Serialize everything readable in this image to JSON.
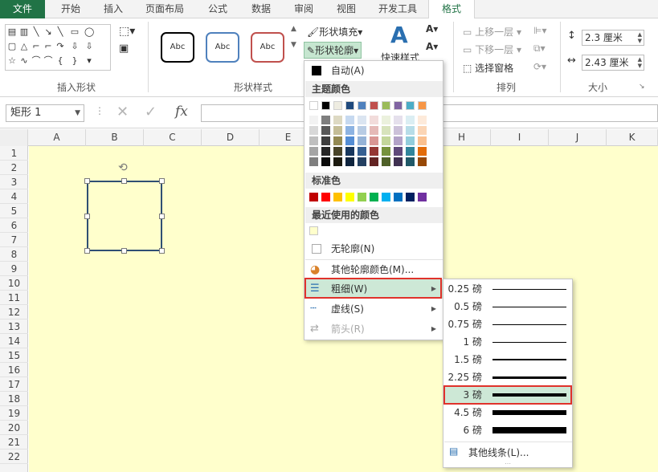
{
  "tabs": [
    "文件",
    "开始",
    "插入",
    "页面布局",
    "公式",
    "数据",
    "审阅",
    "视图",
    "开发工具",
    "格式"
  ],
  "ribbon": {
    "groups": {
      "insert_shapes": "插入形状",
      "shape_styles": "形状样式",
      "arrange": "排列",
      "size": "大小"
    },
    "style_samples": [
      "Abc",
      "Abc",
      "Abc"
    ],
    "shape_fill": "形状填充",
    "shape_outline": "形状轮廓",
    "quick_styles": "快速样式",
    "bring_forward": "上移一层",
    "send_backward": "下移一层",
    "selection_pane": "选择窗格",
    "height_value": "2.3 厘米",
    "width_value": "2.43 厘米"
  },
  "formula_bar": {
    "name_box": "矩形 1",
    "fx": "fx"
  },
  "columns": [
    "A",
    "B",
    "C",
    "D",
    "E",
    "F",
    "G",
    "H",
    "I",
    "J",
    "K"
  ],
  "rows": [
    "1",
    "2",
    "3",
    "4",
    "5",
    "6",
    "7",
    "8",
    "9",
    "10",
    "11",
    "12",
    "13",
    "14",
    "15",
    "16",
    "17",
    "18",
    "19",
    "20",
    "21",
    "22"
  ],
  "outline_menu": {
    "auto": "自动(A)",
    "theme_colors_header": "主题颜色",
    "standard_colors_header": "标准色",
    "recent_colors_header": "最近使用的颜色",
    "no_outline": "无轮廓(N)",
    "more_colors": "其他轮廓颜色(M)...",
    "weight": "粗细(W)",
    "dashes": "虚线(S)",
    "arrows": "箭头(R)",
    "theme_top_row": [
      "#ffffff",
      "#000000",
      "#eeece1",
      "#1f497d",
      "#4f81bd",
      "#c0504d",
      "#9bbb59",
      "#8064a2",
      "#4bacc6",
      "#f79646"
    ],
    "theme_shades": [
      [
        "#f2f2f2",
        "#d8d8d8",
        "#bfbfbf",
        "#a5a5a5",
        "#7f7f7f"
      ],
      [
        "#7f7f7f",
        "#595959",
        "#3f3f3f",
        "#262626",
        "#0c0c0c"
      ],
      [
        "#ddd9c3",
        "#c4bd97",
        "#938953",
        "#494429",
        "#1d1b10"
      ],
      [
        "#c6d9f0",
        "#8db3e2",
        "#548dd4",
        "#17365d",
        "#0f243e"
      ],
      [
        "#dbe5f1",
        "#b8cce4",
        "#95b3d7",
        "#366092",
        "#244061"
      ],
      [
        "#f2dcdb",
        "#e5b9b7",
        "#d99694",
        "#953734",
        "#632423"
      ],
      [
        "#ebf1dd",
        "#d7e3bc",
        "#c3d69b",
        "#76923c",
        "#4f6128"
      ],
      [
        "#e5e0ec",
        "#ccc1d9",
        "#b2a2c7",
        "#5f497a",
        "#3f3151"
      ],
      [
        "#dbeef3",
        "#b7dde8",
        "#92cddc",
        "#31859b",
        "#205867"
      ],
      [
        "#fdeada",
        "#fbd5b5",
        "#fac08f",
        "#e36c09",
        "#974806"
      ]
    ],
    "standard_colors": [
      "#c00000",
      "#ff0000",
      "#ffc000",
      "#ffff00",
      "#92d050",
      "#00b050",
      "#00b0f0",
      "#0070c0",
      "#002060",
      "#7030a0"
    ],
    "recent_color": "#ffffcc"
  },
  "weight_menu": {
    "options": [
      {
        "label": "0.25 磅",
        "pt": 0.25
      },
      {
        "label": "0.5 磅",
        "pt": 0.5
      },
      {
        "label": "0.75 磅",
        "pt": 0.75
      },
      {
        "label": "1 磅",
        "pt": 1
      },
      {
        "label": "1.5 磅",
        "pt": 1.5
      },
      {
        "label": "2.25 磅",
        "pt": 2.25
      },
      {
        "label": "3 磅",
        "pt": 3
      },
      {
        "label": "4.5 磅",
        "pt": 4.5
      },
      {
        "label": "6 磅",
        "pt": 6
      }
    ],
    "selected": "3 磅",
    "more_lines": "其他线条(L)..."
  },
  "colors": {
    "accent": "#217346",
    "sheet_fill": "#ffffcc",
    "shape_border": "#2f4f74",
    "highlight": "#e0322b"
  }
}
